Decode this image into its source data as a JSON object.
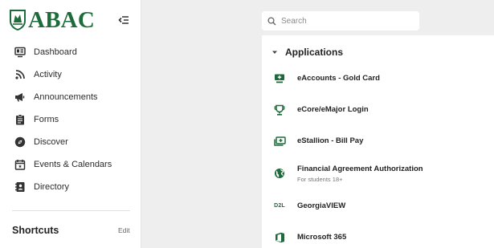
{
  "brand": {
    "name": "ABAC",
    "color": "#1d6b3a"
  },
  "sidebar": {
    "collapse_icon": "collapse-menu-icon",
    "items": [
      {
        "label": "Dashboard",
        "icon": "dashboard-icon"
      },
      {
        "label": "Activity",
        "icon": "rss-feed-icon"
      },
      {
        "label": "Announcements",
        "icon": "megaphone-icon"
      },
      {
        "label": "Forms",
        "icon": "clipboard-icon"
      },
      {
        "label": "Discover",
        "icon": "compass-icon"
      },
      {
        "label": "Events & Calendars",
        "icon": "calendar-icon"
      },
      {
        "label": "Directory",
        "icon": "contacts-book-icon"
      }
    ],
    "shortcuts": {
      "title": "Shortcuts",
      "edit_label": "Edit"
    }
  },
  "search": {
    "placeholder": "Search",
    "value": ""
  },
  "applications": {
    "title": "Applications",
    "expanded": true,
    "items": [
      {
        "name": "eAccounts - Gold Card",
        "subtitle": "",
        "icon": "card-reader-icon"
      },
      {
        "name": "eCore/eMajor Login",
        "subtitle": "",
        "icon": "trophy-icon"
      },
      {
        "name": "eStallion - Bill Pay",
        "subtitle": "",
        "icon": "add-payment-icon"
      },
      {
        "name": "Financial Agreement Authorization",
        "subtitle": "For students 18+",
        "icon": "globe-icon"
      },
      {
        "name": "GeorgiaVIEW",
        "subtitle": "",
        "icon": "d2l-logo-icon",
        "icon_text": "D2L"
      },
      {
        "name": "Microsoft 365",
        "subtitle": "",
        "icon": "office-logo-icon"
      }
    ]
  }
}
